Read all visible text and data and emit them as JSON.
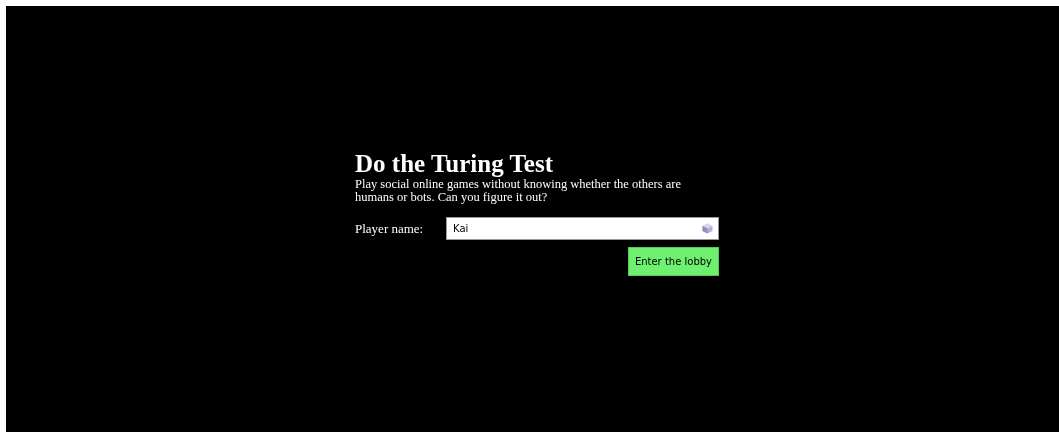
{
  "title": "Do the Turing Test",
  "description": "Play social online games without knowing whether the others are humans or bots. Can you figure it out?",
  "name_field": {
    "label": "Player name:",
    "value": "Kai"
  },
  "button": "Enter the lobby"
}
